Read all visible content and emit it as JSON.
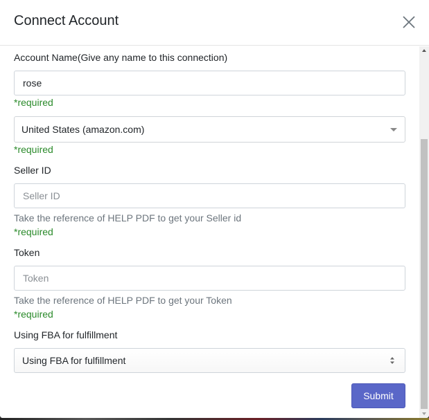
{
  "modal": {
    "title": "Connect Account",
    "close_icon": "close-icon"
  },
  "form": {
    "account_name": {
      "label": "Account Name(Give any name to this connection)",
      "value": "rose",
      "required_text": "*required"
    },
    "marketplace": {
      "selected": "United States (amazon.com)",
      "required_text": "*required"
    },
    "seller_id": {
      "label": "Seller ID",
      "placeholder": "Seller ID",
      "help": "Take the reference of HELP PDF to get your Seller id",
      "required_text": "*required"
    },
    "token": {
      "label": "Token",
      "placeholder": "Token",
      "help": "Take the reference of HELP PDF to get your Token",
      "required_text": "*required"
    },
    "fba": {
      "label": "Using FBA for fulfillment",
      "selected": "Using FBA for fulfillment"
    },
    "submit_label": "Submit"
  },
  "colors": {
    "primary_button": "#5a67c8",
    "required_text": "#2a8a2a",
    "help_text": "#6c757d"
  }
}
